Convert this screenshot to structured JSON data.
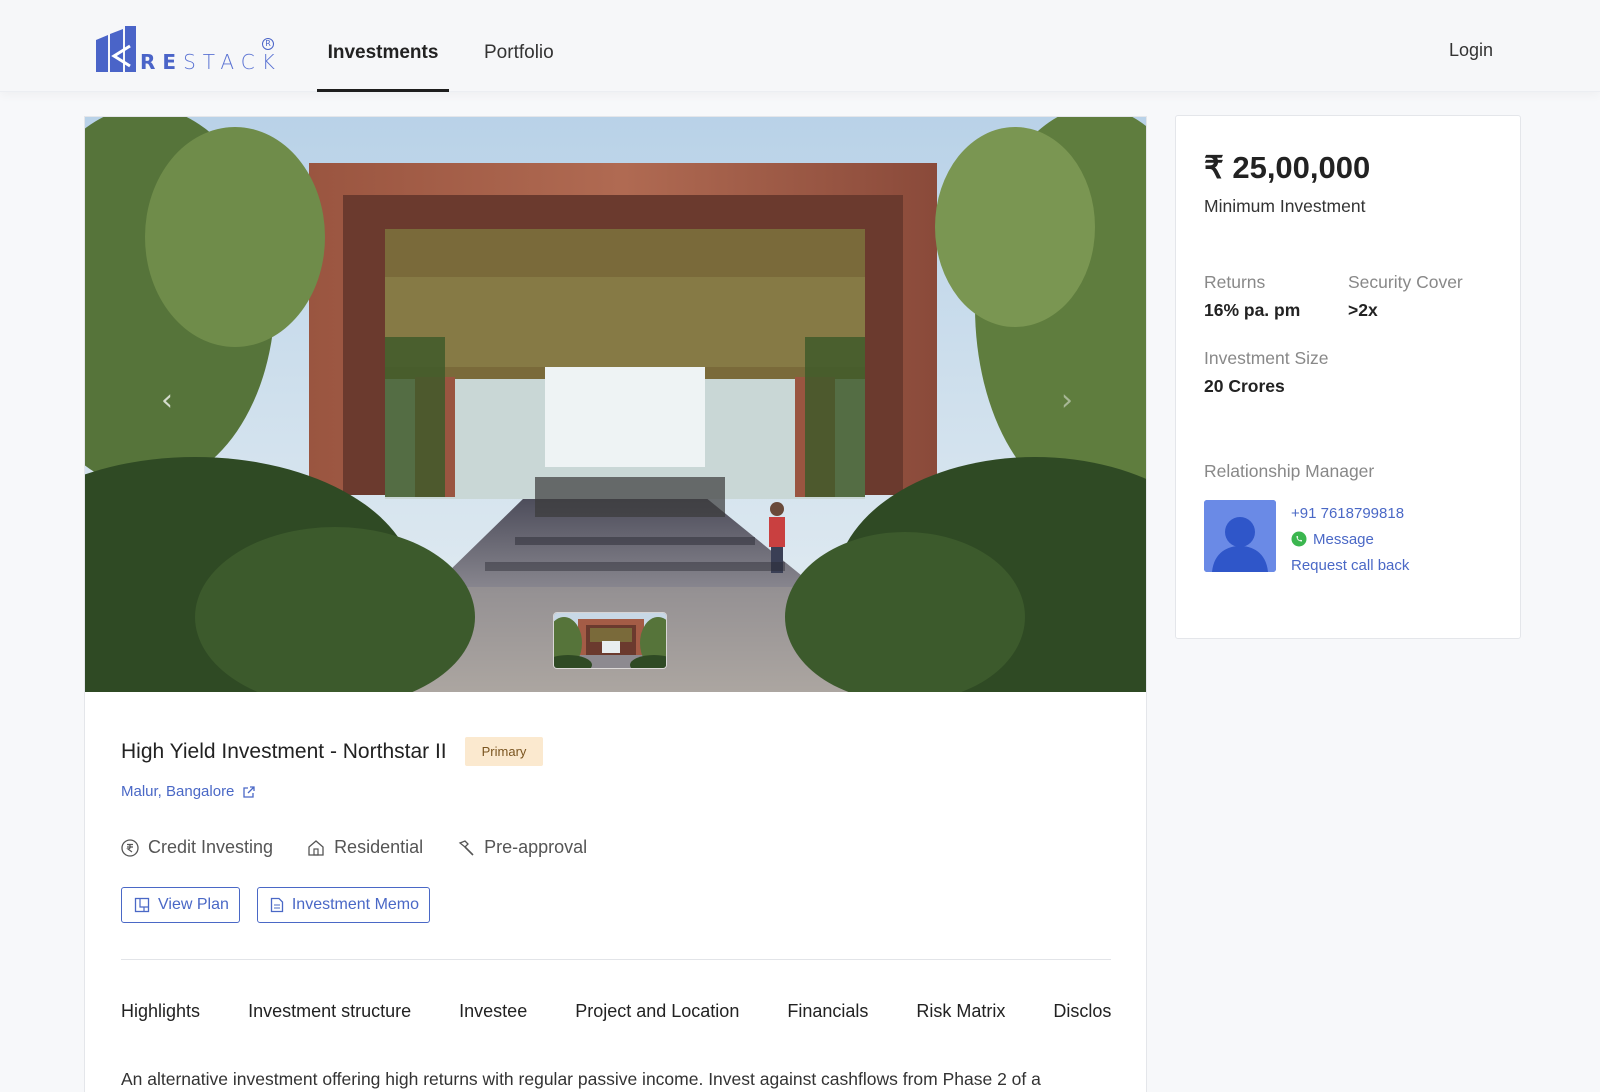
{
  "brand": {
    "name_bold": "RE",
    "name_light": "STACK",
    "reg_mark": "R"
  },
  "nav": {
    "tabs": [
      {
        "label": "Investments",
        "active": true
      },
      {
        "label": "Portfolio",
        "active": false
      }
    ],
    "login_label": "Login"
  },
  "carousel": {
    "prev_icon": "‹",
    "next_icon": "›"
  },
  "project": {
    "title": "High Yield Investment - Northstar II",
    "badge": "Primary",
    "location": "Malur, Bangalore",
    "tags": [
      {
        "icon": "rupee-circle-icon",
        "label": "Credit Investing"
      },
      {
        "icon": "house-icon",
        "label": "Residential"
      },
      {
        "icon": "hammer-icon",
        "label": "Pre-approval"
      }
    ],
    "buttons": {
      "view_plan": "View Plan",
      "investment_memo": "Investment Memo"
    },
    "section_tabs": [
      "Highlights",
      "Investment structure",
      "Investee",
      "Project and Location",
      "Financials",
      "Risk Matrix",
      "Disclosures"
    ],
    "description": "An alternative investment offering high returns with regular passive income. Invest against cashflows from Phase 2 of a"
  },
  "summary": {
    "price": "₹ 25,00,000",
    "price_label": "Minimum Investment",
    "returns_label": "Returns",
    "returns_value": "16% pa. pm",
    "security_label": "Security Cover",
    "security_value": ">2x",
    "size_label": "Investment Size",
    "size_value": "20 Crores",
    "rm_label": "Relationship Manager",
    "rm_phone": "+91 7618799818",
    "rm_message": "Message",
    "rm_callback": "Request call back"
  },
  "colors": {
    "brand_blue": "#4a64c8",
    "link_blue": "#4a68c6",
    "badge_bg": "#fbe9cf",
    "whatsapp_green": "#3bb64f"
  }
}
